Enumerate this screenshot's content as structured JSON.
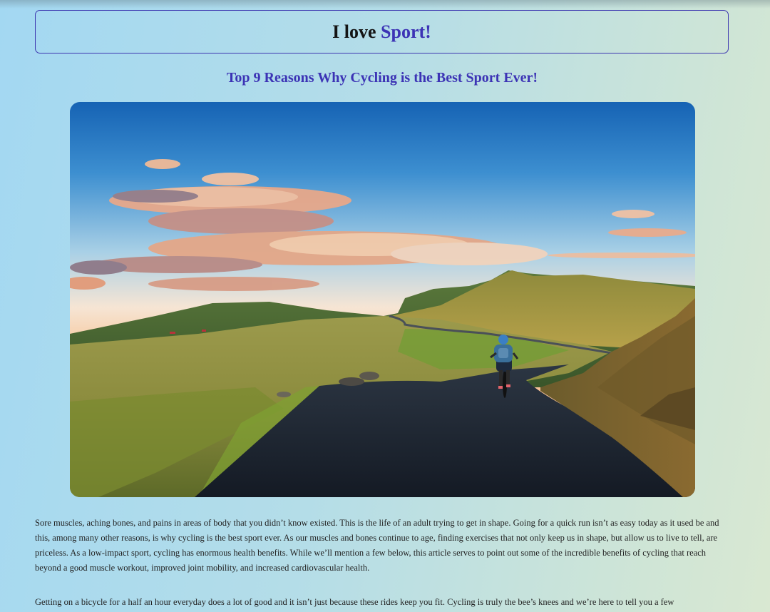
{
  "header": {
    "title_prefix": "I love ",
    "title_accent": "Sport!"
  },
  "article": {
    "title": "Top 9 Reasons Why Cycling is the Best Sport Ever!",
    "image_icon": "cyclist-landscape-photo",
    "paragraphs": [
      "Sore muscles, aching bones, and pains in areas of body that you didn’t know existed. This is the life of an adult trying to get in shape. Going for a quick run isn’t as easy today as it used be and this, among many other reasons, is why cycling is the best sport ever. As our muscles and bones continue to age, finding exercises that not only keep us in shape, but allow us to live to tell, are priceless. As a low-impact sport, cycling has enormous health benefits. While we’ll mention a few below, this article serves to point out some of the incredible benefits of cycling that reach beyond a good muscle workout, improved joint mobility, and increased cardiovascular health.",
      "Getting on a bicycle for a half an hour everyday does a lot of good and it isn’t just because these rides keep you fit. Cycling is truly the bee’s knees and we’re here to tell you a few"
    ]
  },
  "colors": {
    "accent": "#3c33b5",
    "border": "#3c36b0"
  }
}
